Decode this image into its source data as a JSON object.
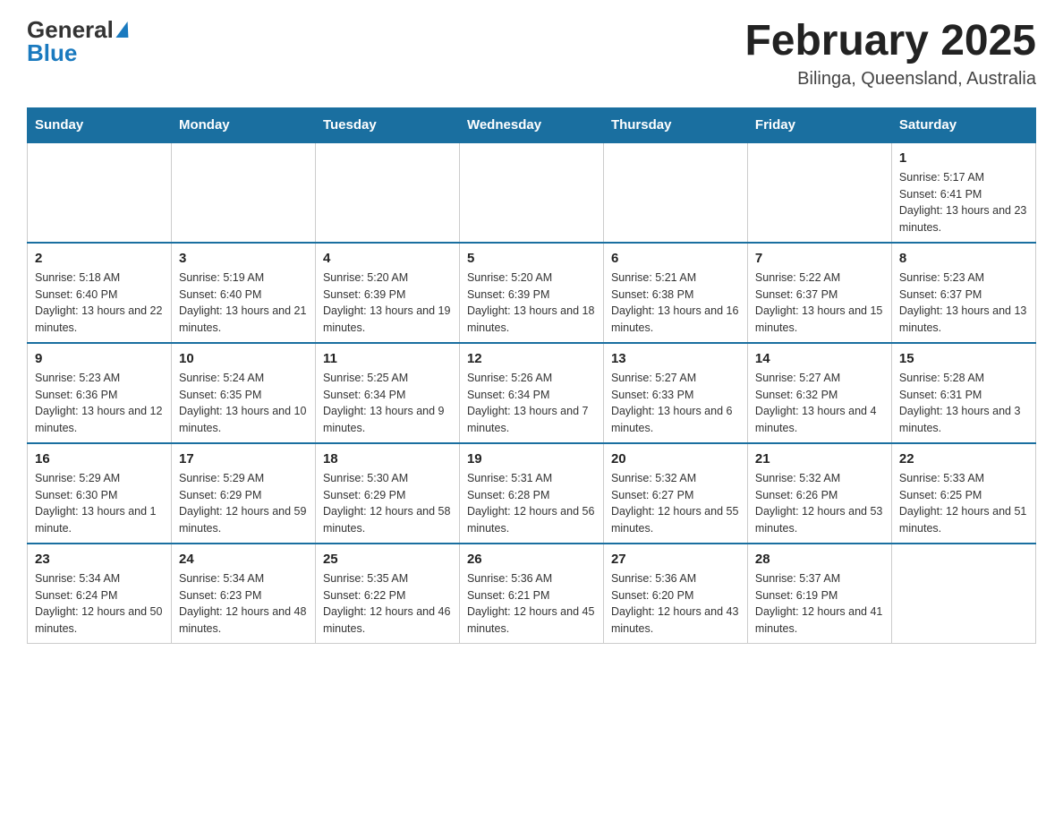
{
  "header": {
    "logo_general": "General",
    "logo_blue": "Blue",
    "title": "February 2025",
    "location": "Bilinga, Queensland, Australia"
  },
  "calendar": {
    "days_of_week": [
      "Sunday",
      "Monday",
      "Tuesday",
      "Wednesday",
      "Thursday",
      "Friday",
      "Saturday"
    ],
    "weeks": [
      [
        {
          "day": "",
          "info": ""
        },
        {
          "day": "",
          "info": ""
        },
        {
          "day": "",
          "info": ""
        },
        {
          "day": "",
          "info": ""
        },
        {
          "day": "",
          "info": ""
        },
        {
          "day": "",
          "info": ""
        },
        {
          "day": "1",
          "info": "Sunrise: 5:17 AM\nSunset: 6:41 PM\nDaylight: 13 hours and 23 minutes."
        }
      ],
      [
        {
          "day": "2",
          "info": "Sunrise: 5:18 AM\nSunset: 6:40 PM\nDaylight: 13 hours and 22 minutes."
        },
        {
          "day": "3",
          "info": "Sunrise: 5:19 AM\nSunset: 6:40 PM\nDaylight: 13 hours and 21 minutes."
        },
        {
          "day": "4",
          "info": "Sunrise: 5:20 AM\nSunset: 6:39 PM\nDaylight: 13 hours and 19 minutes."
        },
        {
          "day": "5",
          "info": "Sunrise: 5:20 AM\nSunset: 6:39 PM\nDaylight: 13 hours and 18 minutes."
        },
        {
          "day": "6",
          "info": "Sunrise: 5:21 AM\nSunset: 6:38 PM\nDaylight: 13 hours and 16 minutes."
        },
        {
          "day": "7",
          "info": "Sunrise: 5:22 AM\nSunset: 6:37 PM\nDaylight: 13 hours and 15 minutes."
        },
        {
          "day": "8",
          "info": "Sunrise: 5:23 AM\nSunset: 6:37 PM\nDaylight: 13 hours and 13 minutes."
        }
      ],
      [
        {
          "day": "9",
          "info": "Sunrise: 5:23 AM\nSunset: 6:36 PM\nDaylight: 13 hours and 12 minutes."
        },
        {
          "day": "10",
          "info": "Sunrise: 5:24 AM\nSunset: 6:35 PM\nDaylight: 13 hours and 10 minutes."
        },
        {
          "day": "11",
          "info": "Sunrise: 5:25 AM\nSunset: 6:34 PM\nDaylight: 13 hours and 9 minutes."
        },
        {
          "day": "12",
          "info": "Sunrise: 5:26 AM\nSunset: 6:34 PM\nDaylight: 13 hours and 7 minutes."
        },
        {
          "day": "13",
          "info": "Sunrise: 5:27 AM\nSunset: 6:33 PM\nDaylight: 13 hours and 6 minutes."
        },
        {
          "day": "14",
          "info": "Sunrise: 5:27 AM\nSunset: 6:32 PM\nDaylight: 13 hours and 4 minutes."
        },
        {
          "day": "15",
          "info": "Sunrise: 5:28 AM\nSunset: 6:31 PM\nDaylight: 13 hours and 3 minutes."
        }
      ],
      [
        {
          "day": "16",
          "info": "Sunrise: 5:29 AM\nSunset: 6:30 PM\nDaylight: 13 hours and 1 minute."
        },
        {
          "day": "17",
          "info": "Sunrise: 5:29 AM\nSunset: 6:29 PM\nDaylight: 12 hours and 59 minutes."
        },
        {
          "day": "18",
          "info": "Sunrise: 5:30 AM\nSunset: 6:29 PM\nDaylight: 12 hours and 58 minutes."
        },
        {
          "day": "19",
          "info": "Sunrise: 5:31 AM\nSunset: 6:28 PM\nDaylight: 12 hours and 56 minutes."
        },
        {
          "day": "20",
          "info": "Sunrise: 5:32 AM\nSunset: 6:27 PM\nDaylight: 12 hours and 55 minutes."
        },
        {
          "day": "21",
          "info": "Sunrise: 5:32 AM\nSunset: 6:26 PM\nDaylight: 12 hours and 53 minutes."
        },
        {
          "day": "22",
          "info": "Sunrise: 5:33 AM\nSunset: 6:25 PM\nDaylight: 12 hours and 51 minutes."
        }
      ],
      [
        {
          "day": "23",
          "info": "Sunrise: 5:34 AM\nSunset: 6:24 PM\nDaylight: 12 hours and 50 minutes."
        },
        {
          "day": "24",
          "info": "Sunrise: 5:34 AM\nSunset: 6:23 PM\nDaylight: 12 hours and 48 minutes."
        },
        {
          "day": "25",
          "info": "Sunrise: 5:35 AM\nSunset: 6:22 PM\nDaylight: 12 hours and 46 minutes."
        },
        {
          "day": "26",
          "info": "Sunrise: 5:36 AM\nSunset: 6:21 PM\nDaylight: 12 hours and 45 minutes."
        },
        {
          "day": "27",
          "info": "Sunrise: 5:36 AM\nSunset: 6:20 PM\nDaylight: 12 hours and 43 minutes."
        },
        {
          "day": "28",
          "info": "Sunrise: 5:37 AM\nSunset: 6:19 PM\nDaylight: 12 hours and 41 minutes."
        },
        {
          "day": "",
          "info": ""
        }
      ]
    ]
  }
}
